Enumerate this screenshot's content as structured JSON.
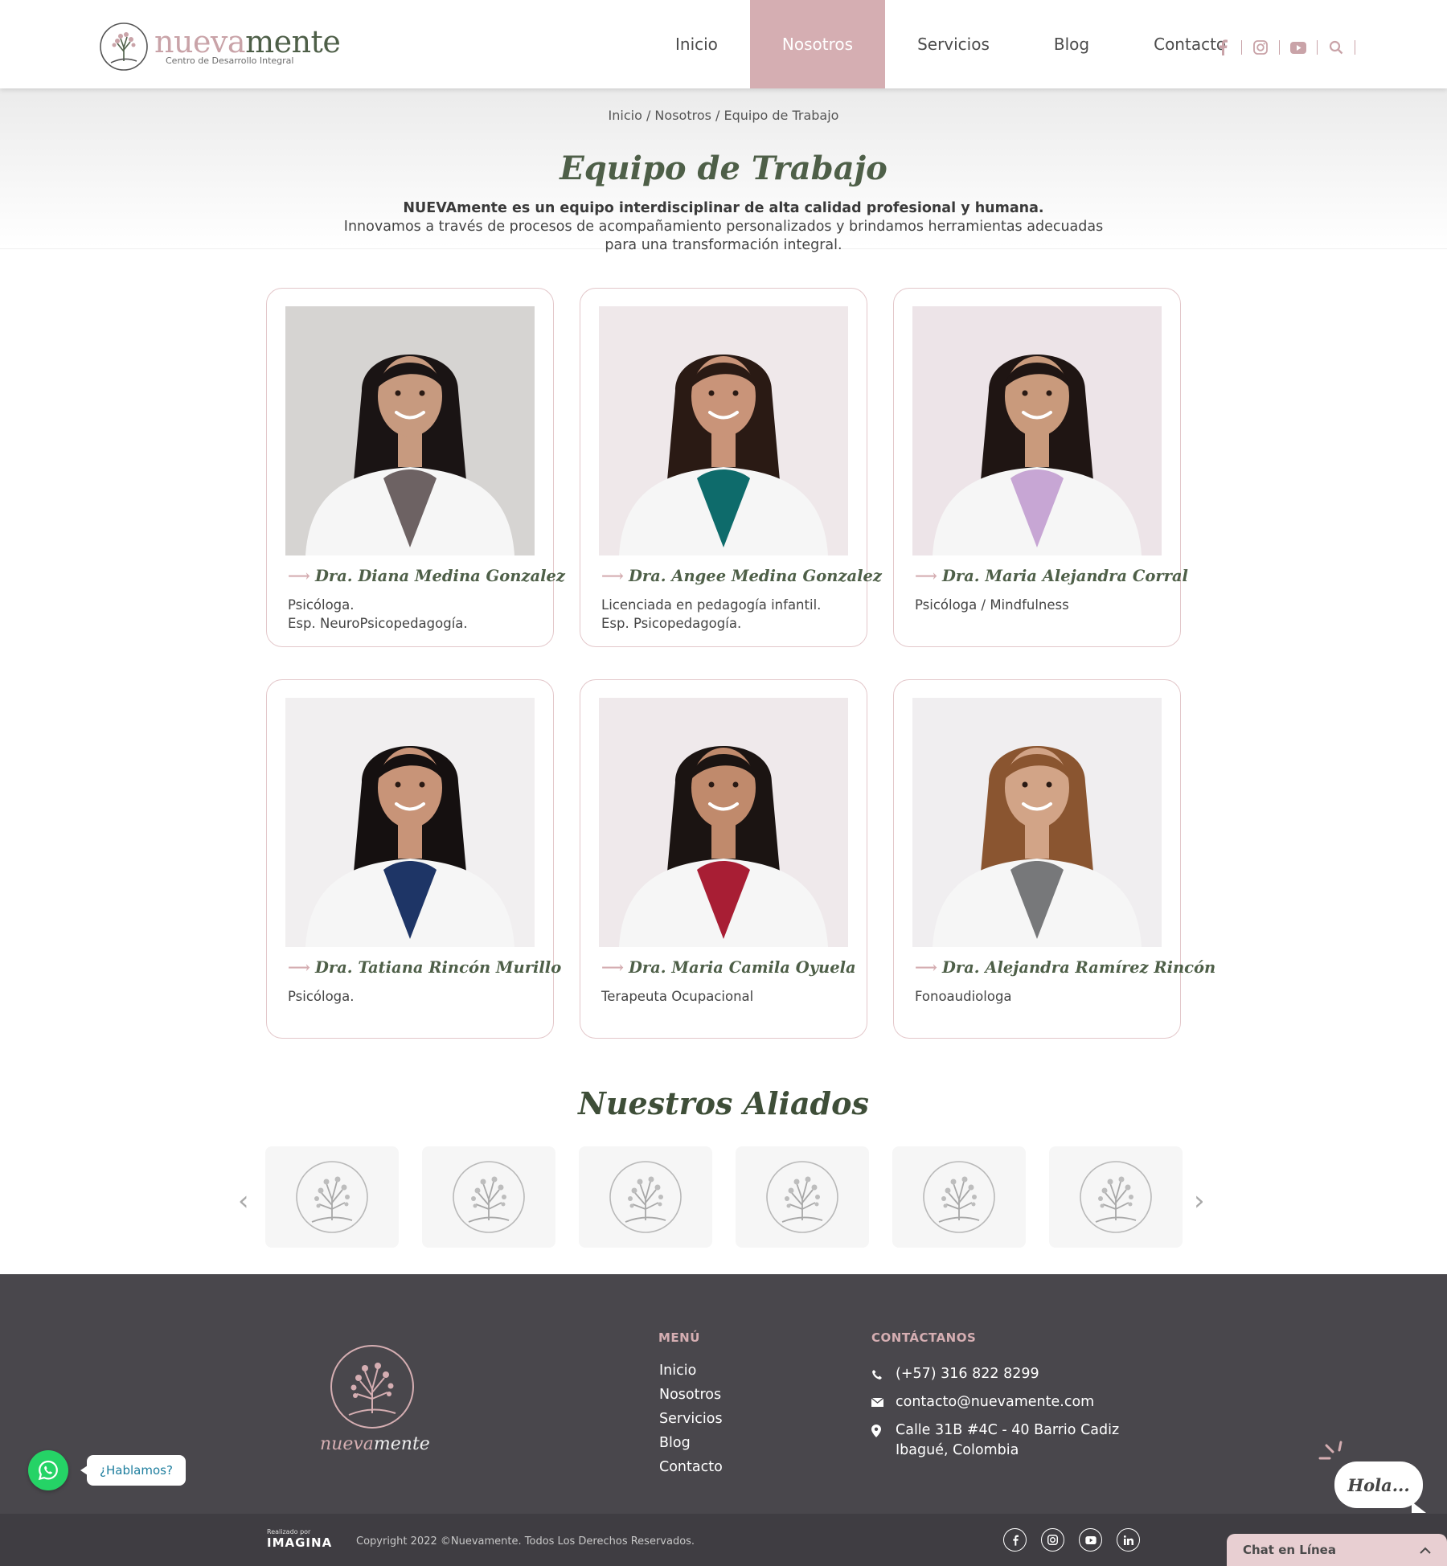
{
  "brand": {
    "logo_word_light": "nueva",
    "logo_word_dark": "mente",
    "logo_sub": "Centro de Desarrollo Integral",
    "accent": "#d5aeb2",
    "green": "#4e5f48"
  },
  "nav": {
    "items": [
      "Inicio",
      "Nosotros",
      "Servicios",
      "Blog",
      "Contacto"
    ],
    "active": "Nosotros",
    "icons": [
      "facebook-icon",
      "instagram-icon",
      "youtube-icon",
      "search-icon"
    ]
  },
  "hero": {
    "breadcrumb": "Inicio / Nosotros / Equipo de Trabajo",
    "title": "Equipo de Trabajo",
    "intro_strong": "NUEVAmente es un equipo interdisciplinar de alta calidad profesional y humana.",
    "intro_line2": "Innovamos a través de procesos de acompañamiento personalizados y brindamos herramientas adecuadas",
    "intro_line3": "para una transformación integral."
  },
  "team": [
    {
      "name": "Dra. Diana Medina Gonzalez",
      "role1": "Psicóloga.",
      "role2": "Esp. NeuroPsicopedagogía.",
      "top": "#6d6263",
      "hair": "#1a1414",
      "skin": "#c79a7f",
      "bg": "#d6d4d2"
    },
    {
      "name": "Dra. Angee Medina Gonzalez",
      "role1": "Licenciada en pedagogía infantil.",
      "role2": "Esp. Psicopedagogía.",
      "top": "#0e6b6b",
      "hair": "#2a1a14",
      "skin": "#c99479",
      "bg": "#efe8ea"
    },
    {
      "name": "Dra. Maria Alejandra Corral",
      "role1": "Psicóloga / Mindfulness",
      "role2": "",
      "top": "#c7a6d4",
      "hair": "#1f1513",
      "skin": "#c99a7c",
      "bg": "#ede4e8"
    },
    {
      "name": "Dra. Tatiana Rincón Murillo",
      "role1": "Psicóloga.",
      "role2": "",
      "top": "#1e3566",
      "hair": "#151010",
      "skin": "#c89478",
      "bg": "#f1eff0"
    },
    {
      "name": "Dra. Maria Camila Oyuela",
      "role1": "Terapeuta Ocupacional",
      "role2": "",
      "top": "#a81e34",
      "hair": "#1b1412",
      "skin": "#c08a6c",
      "bg": "#efe9eb"
    },
    {
      "name": "Dra. Alejandra Ramírez Rincón",
      "role1": "Fonoaudiologa",
      "role2": "",
      "top": "#77787a",
      "hair": "#8a5530",
      "skin": "#d2a487",
      "bg": "#f0eef0"
    }
  ],
  "allies": {
    "title": "Nuestros Aliados",
    "count": 6
  },
  "footer": {
    "logo_word_light": "nueva",
    "logo_word_dark": "mente",
    "menu_title": "MENÚ",
    "menu": [
      "Inicio",
      "Nosotros",
      "Servicios",
      "Blog",
      "Contacto"
    ],
    "contact_title": "CONTÁCTANOS",
    "phone": "(+57) 316 822 8299",
    "email": "contacto@nuevamente.com",
    "address1": "Calle 31B #4C - 40 Barrio Cadiz",
    "address2": "Ibagué, Colombia",
    "made_by_label": "Realizado por",
    "made_by_brand": "IMAGINA",
    "copyright": "Copyright 2022 ©Nuevamente. Todos Los Derechos Reservados."
  },
  "widgets": {
    "whatsapp_label": "¿Hablamos?",
    "hola": "Hola...",
    "chat": "Chat en Línea"
  }
}
